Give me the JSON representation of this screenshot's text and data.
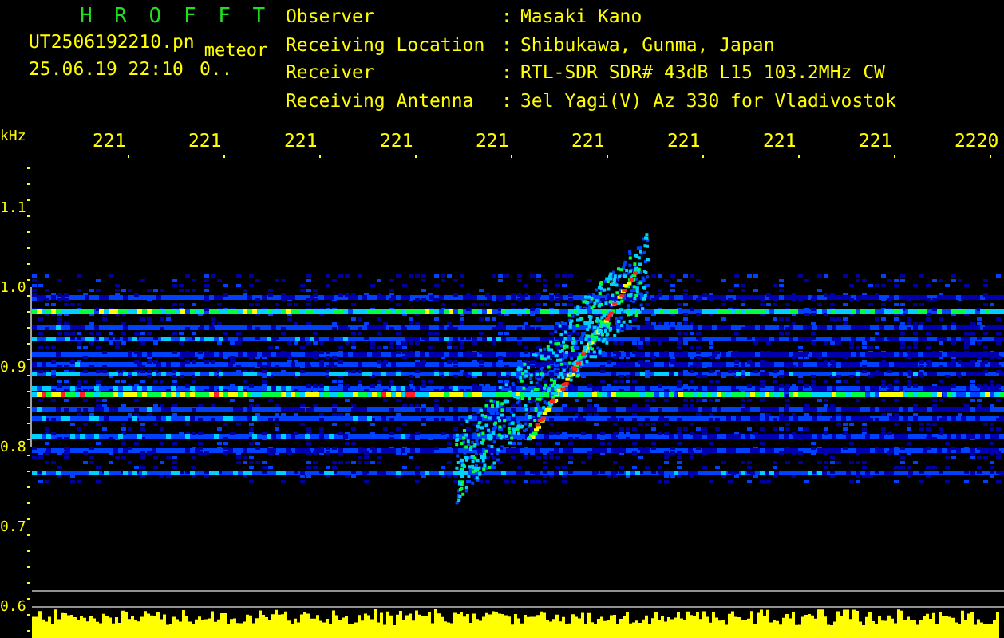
{
  "header": {
    "title": "H R O F F T",
    "filename": "UT2506192210.pn",
    "tag": "meteor",
    "timestamp": "25.06.19 22:10",
    "status": "0.."
  },
  "station": [
    {
      "label": "Observer",
      "separator": ":",
      "value": "Masaki Kano"
    },
    {
      "label": "Receiving Location",
      "separator": ":",
      "value": "Shibukawa, Gunma, Japan"
    },
    {
      "label": "Receiver",
      "separator": ":",
      "value": "RTL-SDR SDR# 43dB L15 103.2MHz CW"
    },
    {
      "label": "Receiving Antenna",
      "separator": ":",
      "value": "3el Yagi(V) Az 330 for Vladivostok"
    }
  ],
  "plot": {
    "unit": "kHz",
    "x_labels": [
      "221",
      "221",
      "221",
      "221",
      "221",
      "221",
      "221",
      "221",
      "221",
      "2220"
    ],
    "y_labels": [
      "1.1",
      "1.0",
      "0.9",
      "0.8",
      "0.7",
      "0.6"
    ]
  }
}
